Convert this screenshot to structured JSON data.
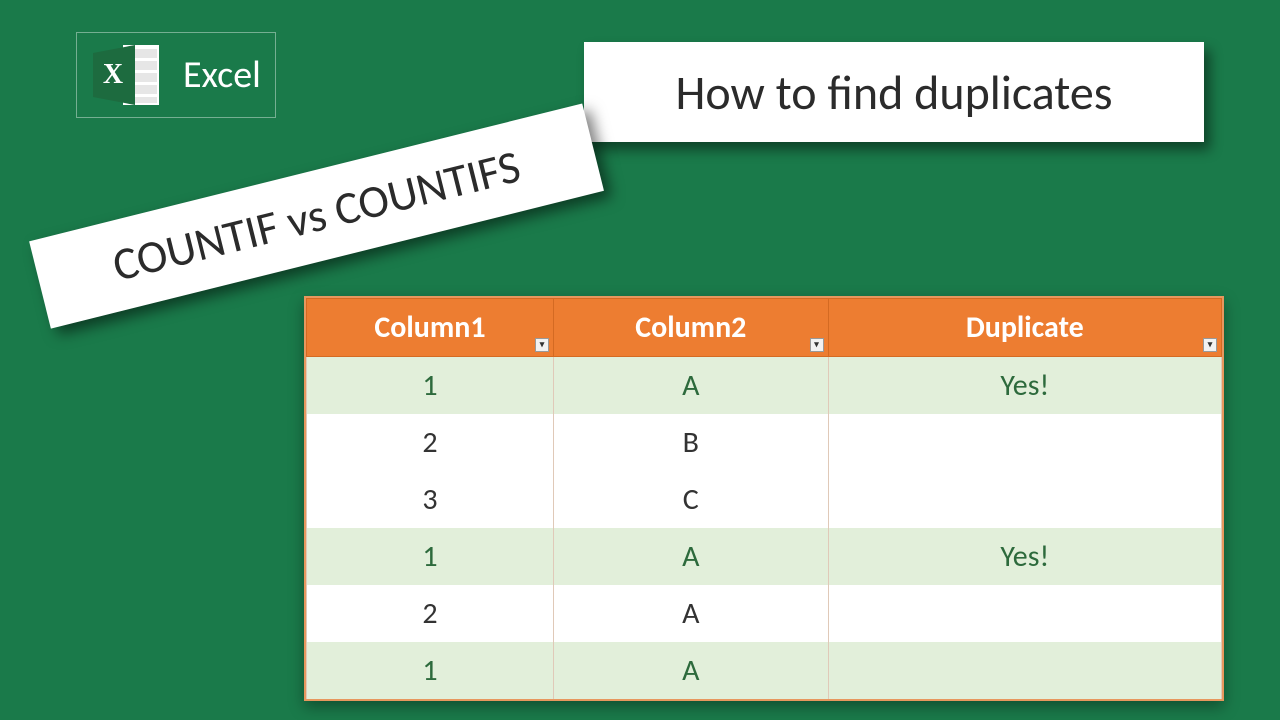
{
  "logo": {
    "label": "Excel",
    "letter": "X"
  },
  "title": "How to find duplicates",
  "banner": "COUNTIF vs COUNTIFS",
  "table": {
    "headers": [
      "Column1",
      "Column2",
      "Duplicate"
    ],
    "rows": [
      {
        "c1": "1",
        "c2": "A",
        "c3": "Yes!",
        "band": true
      },
      {
        "c1": "2",
        "c2": "B",
        "c3": "",
        "band": false
      },
      {
        "c1": "3",
        "c2": "C",
        "c3": "",
        "band": false
      },
      {
        "c1": "1",
        "c2": "A",
        "c3": "Yes!",
        "band": true
      },
      {
        "c1": "2",
        "c2": "A",
        "c3": "",
        "band": false
      },
      {
        "c1": "1",
        "c2": "A",
        "c3": "",
        "band": true
      }
    ]
  }
}
